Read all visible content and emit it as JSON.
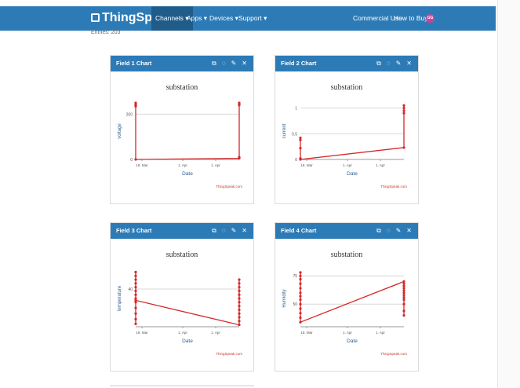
{
  "nav": {
    "brand": "ThingSpeak",
    "trademark": "™",
    "menu": [
      "Channels ▾",
      "Apps ▾",
      "Devices ▾",
      "Support ▾"
    ],
    "right": [
      "Commercial Use",
      "How to Buy"
    ],
    "avatar_initials": "GG"
  },
  "entries_text": "Entries: 203",
  "colors": {
    "nav": "#2d7bb6",
    "line": "#d62728",
    "avatar": "#c64599"
  },
  "panels": [
    {
      "header": "Field 1 Chart",
      "title": "substation",
      "ylabel": "voltage",
      "xlabel": "Date",
      "credit": "ThingSpeak.com"
    },
    {
      "header": "Field 2 Chart",
      "title": "substation",
      "ylabel": "current",
      "xlabel": "Date",
      "credit": "ThingSpeak.com"
    },
    {
      "header": "Field 3 Chart",
      "title": "substation",
      "ylabel": "temperature",
      "xlabel": "Date",
      "credit": "ThingSpeak.com"
    },
    {
      "header": "Field 4 Chart",
      "title": "substation",
      "ylabel": "Humidity",
      "xlabel": "Date",
      "credit": "ThingSpeak.com"
    }
  ],
  "chart_data": [
    {
      "type": "line",
      "title": "substation",
      "xlabel": "Date",
      "ylabel": "voltage",
      "x_ticks": [
        "18. Mar",
        "1. Apr",
        "1. Apr"
      ],
      "y_ticks": [
        0,
        200
      ],
      "ylim": [
        0,
        250
      ],
      "series": [
        {
          "values": [
            {
              "x": 0,
              "y": 250
            },
            {
              "x": 0,
              "y": 245
            },
            {
              "x": 0,
              "y": 240
            },
            {
              "x": 0,
              "y": 235
            },
            {
              "x": 0,
              "y": 0
            },
            {
              "x": 1,
              "y": 5
            },
            {
              "x": 1,
              "y": 10
            },
            {
              "x": 1,
              "y": 240
            },
            {
              "x": 1,
              "y": 245
            },
            {
              "x": 1,
              "y": 250
            }
          ]
        }
      ],
      "grid": true
    },
    {
      "type": "line",
      "title": "substation",
      "xlabel": "Date",
      "ylabel": "current",
      "x_ticks": [
        "18. Mar",
        "1. Apr",
        "1. Apr"
      ],
      "y_ticks": [
        0,
        0.5,
        1
      ],
      "ylim": [
        0,
        1.1
      ],
      "series": [
        {
          "values": [
            {
              "x": 0,
              "y": 0.42
            },
            {
              "x": 0,
              "y": 0.38
            },
            {
              "x": 0,
              "y": 0.22
            },
            {
              "x": 0,
              "y": 0.02
            },
            {
              "x": 0,
              "y": 0
            },
            {
              "x": 1,
              "y": 0.23
            },
            {
              "x": 1,
              "y": 0.9
            },
            {
              "x": 1,
              "y": 0.95
            },
            {
              "x": 1,
              "y": 1.0
            },
            {
              "x": 1,
              "y": 1.05
            }
          ]
        }
      ],
      "grid": true
    },
    {
      "type": "line",
      "title": "substation",
      "xlabel": "Date",
      "ylabel": "temperature",
      "x_ticks": [
        "18. Mar",
        "1. Apr",
        "1. Apr"
      ],
      "y_ticks": [
        40
      ],
      "ylim": [
        0,
        60
      ],
      "series": [
        {
          "values": [
            {
              "x": 0,
              "y": 58
            },
            {
              "x": 0,
              "y": 54
            },
            {
              "x": 0,
              "y": 50
            },
            {
              "x": 0,
              "y": 46
            },
            {
              "x": 0,
              "y": 42
            },
            {
              "x": 0,
              "y": 38
            },
            {
              "x": 0,
              "y": 34
            },
            {
              "x": 0,
              "y": 30
            },
            {
              "x": 0,
              "y": 26
            },
            {
              "x": 0,
              "y": 20
            },
            {
              "x": 0,
              "y": 14
            },
            {
              "x": 0,
              "y": 8
            },
            {
              "x": 0,
              "y": 3
            },
            {
              "x": 0,
              "y": 28
            },
            {
              "x": 1,
              "y": 2
            },
            {
              "x": 1,
              "y": 6
            },
            {
              "x": 1,
              "y": 10
            },
            {
              "x": 1,
              "y": 14
            },
            {
              "x": 1,
              "y": 18
            },
            {
              "x": 1,
              "y": 22
            },
            {
              "x": 1,
              "y": 26
            },
            {
              "x": 1,
              "y": 30
            },
            {
              "x": 1,
              "y": 34
            },
            {
              "x": 1,
              "y": 38
            },
            {
              "x": 1,
              "y": 42
            },
            {
              "x": 1,
              "y": 46
            },
            {
              "x": 1,
              "y": 50
            }
          ]
        }
      ],
      "grid": true
    },
    {
      "type": "line",
      "title": "substation",
      "xlabel": "Date",
      "ylabel": "Humidity",
      "x_ticks": [
        "18. Mar",
        "1. Apr",
        "1. Apr"
      ],
      "y_ticks": [
        50,
        75
      ],
      "ylim": [
        30,
        80
      ],
      "series": [
        {
          "values": [
            {
              "x": 0,
              "y": 78
            },
            {
              "x": 0,
              "y": 75
            },
            {
              "x": 0,
              "y": 72
            },
            {
              "x": 0,
              "y": 68
            },
            {
              "x": 0,
              "y": 64
            },
            {
              "x": 0,
              "y": 60
            },
            {
              "x": 0,
              "y": 57
            },
            {
              "x": 0,
              "y": 54
            },
            {
              "x": 0,
              "y": 50
            },
            {
              "x": 0,
              "y": 46
            },
            {
              "x": 0,
              "y": 42
            },
            {
              "x": 0,
              "y": 38
            },
            {
              "x": 0,
              "y": 34
            },
            {
              "x": 1,
              "y": 70
            },
            {
              "x": 1,
              "y": 68
            },
            {
              "x": 1,
              "y": 66
            },
            {
              "x": 1,
              "y": 64
            },
            {
              "x": 1,
              "y": 62
            },
            {
              "x": 1,
              "y": 60
            },
            {
              "x": 1,
              "y": 58
            },
            {
              "x": 1,
              "y": 56
            },
            {
              "x": 1,
              "y": 54
            },
            {
              "x": 1,
              "y": 50
            },
            {
              "x": 1,
              "y": 44
            },
            {
              "x": 1,
              "y": 40
            }
          ]
        }
      ],
      "grid": true
    }
  ]
}
